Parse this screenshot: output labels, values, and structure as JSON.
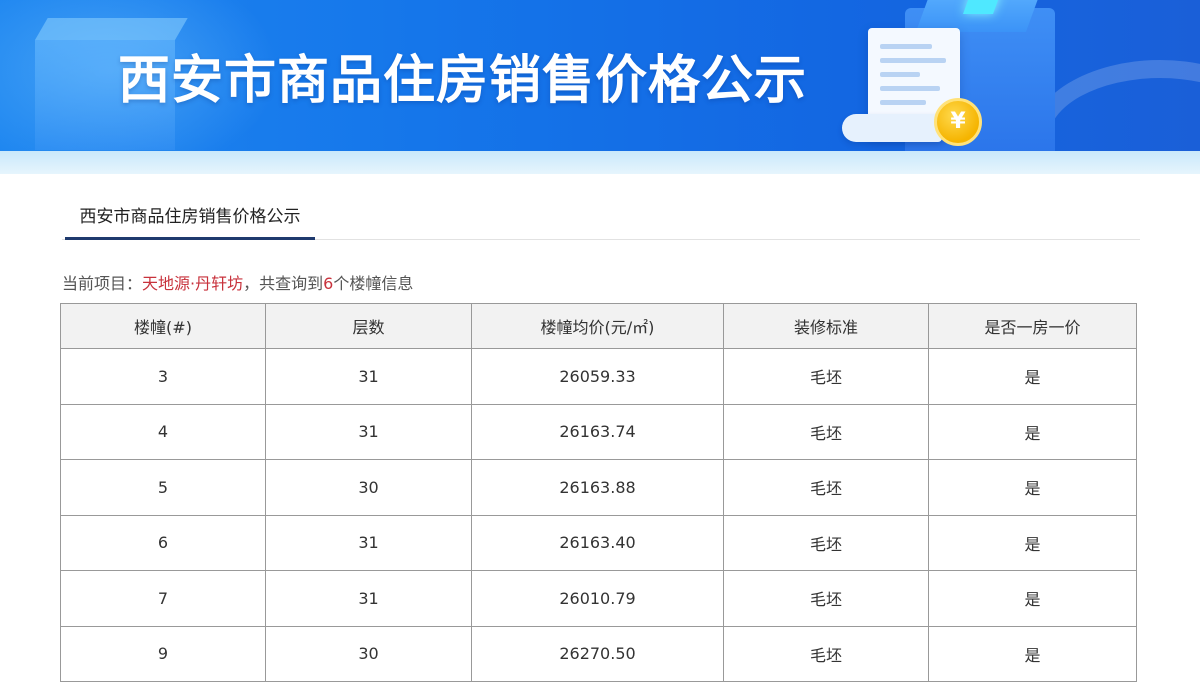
{
  "banner": {
    "title": "西安市商品住房销售价格公示",
    "coin_symbol": "¥",
    "colors": {
      "primary": "#1576ea",
      "band": "#d8eefc",
      "coin": "#f5b400"
    }
  },
  "tabs": [
    {
      "label": "西安市商品住房销售价格公示",
      "active": true
    }
  ],
  "summary": {
    "prefix": "当前项目：",
    "project_name": "天地源·丹轩坊",
    "middle": "，共查询到",
    "count": "6",
    "suffix": "个楼幢信息",
    "highlight_color": "#c8323c"
  },
  "table": {
    "columns": [
      "楼幢(#)",
      "层数",
      "楼幢均价(元/㎡)",
      "装修标准",
      "是否一房一价"
    ],
    "rows": [
      [
        "3",
        "31",
        "26059.33",
        "毛坯",
        "是"
      ],
      [
        "4",
        "31",
        "26163.74",
        "毛坯",
        "是"
      ],
      [
        "5",
        "30",
        "26163.88",
        "毛坯",
        "是"
      ],
      [
        "6",
        "31",
        "26163.40",
        "毛坯",
        "是"
      ],
      [
        "7",
        "31",
        "26010.79",
        "毛坯",
        "是"
      ],
      [
        "9",
        "30",
        "26270.50",
        "毛坯",
        "是"
      ]
    ]
  }
}
